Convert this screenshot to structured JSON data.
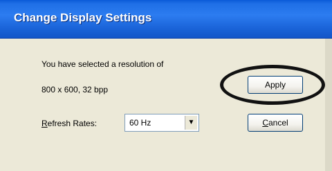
{
  "window": {
    "title": "Change Display Settings"
  },
  "message": {
    "line1": "You have selected a resolution of",
    "line2": "800 x 600, 32 bpp"
  },
  "refresh": {
    "label_accel": "R",
    "label_rest": "efresh Rates:",
    "selected": "60 Hz",
    "dropdown_icon": "chevron-down-icon"
  },
  "buttons": {
    "apply_label": "Apply",
    "cancel_accel": "C",
    "cancel_rest": "ancel"
  },
  "annotation": {
    "type": "hand-drawn-circle",
    "target": "apply-button",
    "color": "#111111"
  },
  "colors": {
    "titlebar": "#1f6fe6",
    "window_bg": "#ece9d8"
  }
}
